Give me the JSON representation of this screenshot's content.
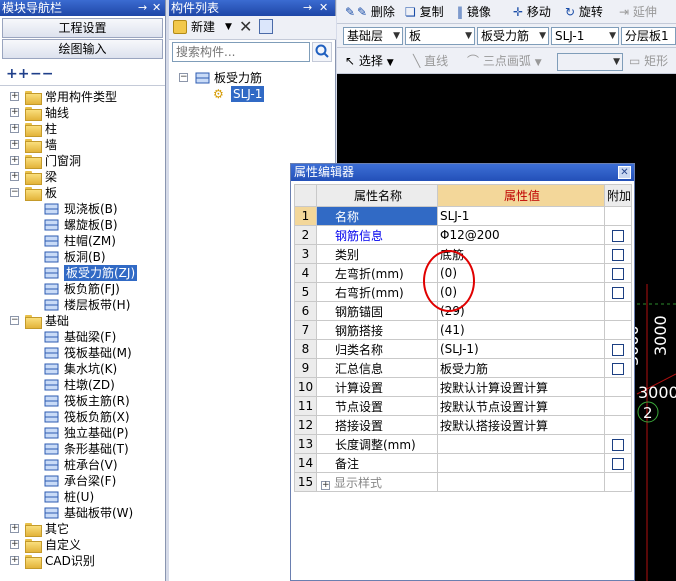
{
  "nav": {
    "title": "模块导航栏",
    "btn_project": "工程设置",
    "btn_draw": "绘图输入",
    "tree": [
      {
        "label": "常用构件类型",
        "indent": 0,
        "folder": true,
        "open": false
      },
      {
        "label": "轴线",
        "indent": 0,
        "folder": true,
        "open": false
      },
      {
        "label": "柱",
        "indent": 0,
        "folder": true,
        "open": false
      },
      {
        "label": "墙",
        "indent": 0,
        "folder": true,
        "open": false
      },
      {
        "label": "门窗洞",
        "indent": 0,
        "folder": true,
        "open": false
      },
      {
        "label": "梁",
        "indent": 0,
        "folder": true,
        "open": false
      },
      {
        "label": "板",
        "indent": 0,
        "folder": true,
        "open": true
      },
      {
        "label": "现浇板(B)",
        "indent": 1,
        "icon": "slab-icon"
      },
      {
        "label": "螺旋板(B)",
        "indent": 1,
        "icon": "spiral-slab-icon"
      },
      {
        "label": "柱帽(ZM)",
        "indent": 1,
        "icon": "column-cap-icon"
      },
      {
        "label": "板洞(B)",
        "indent": 1,
        "icon": "slab-hole-icon"
      },
      {
        "label": "板受力筋(ZJ)",
        "indent": 1,
        "icon": "slab-rebar-icon",
        "selected": true
      },
      {
        "label": "板负筋(FJ)",
        "indent": 1,
        "icon": "negative-rebar-icon"
      },
      {
        "label": "楼层板带(H)",
        "indent": 1,
        "icon": "slab-strip-icon"
      },
      {
        "label": "基础",
        "indent": 0,
        "folder": true,
        "open": true
      },
      {
        "label": "基础梁(F)",
        "indent": 1,
        "icon": "foundation-beam-icon"
      },
      {
        "label": "筏板基础(M)",
        "indent": 1,
        "icon": "raft-foundation-icon"
      },
      {
        "label": "集水坑(K)",
        "indent": 1,
        "icon": "sump-pit-icon"
      },
      {
        "label": "柱墩(ZD)",
        "indent": 1,
        "icon": "pier-icon"
      },
      {
        "label": "筏板主筋(R)",
        "indent": 1,
        "icon": "raft-main-rebar-icon"
      },
      {
        "label": "筏板负筋(X)",
        "indent": 1,
        "icon": "raft-negative-rebar-icon"
      },
      {
        "label": "独立基础(P)",
        "indent": 1,
        "icon": "isolated-footing-icon"
      },
      {
        "label": "条形基础(T)",
        "indent": 1,
        "icon": "strip-footing-icon"
      },
      {
        "label": "桩承台(V)",
        "indent": 1,
        "icon": "pile-cap-icon"
      },
      {
        "label": "承台梁(F)",
        "indent": 1,
        "icon": "cap-beam-icon"
      },
      {
        "label": "桩(U)",
        "indent": 1,
        "icon": "pile-icon"
      },
      {
        "label": "基础板带(W)",
        "indent": 1,
        "icon": "foundation-strip-icon"
      },
      {
        "label": "其它",
        "indent": 0,
        "folder": true,
        "open": false
      },
      {
        "label": "自定义",
        "indent": 0,
        "folder": true,
        "open": false
      },
      {
        "label": "CAD识别",
        "indent": 0,
        "folder": true,
        "open": false
      }
    ]
  },
  "comp": {
    "title": "构件列表",
    "new_label": "新建",
    "search_placeholder": "搜索构件...",
    "tree_root": "板受力筋",
    "tree_child": "SLJ-1"
  },
  "toolbar": {
    "delete": "删除",
    "copy": "复制",
    "mirror": "镜像",
    "move": "移动",
    "rotate": "旋转",
    "extend": "延伸",
    "select": "选择",
    "line": "直线",
    "arc": "三点画弧",
    "rect": "矩形",
    "combo_floor": "基础层",
    "combo_type": "板",
    "combo_sub": "板受力筋",
    "combo_name": "SLJ-1",
    "combo_layer": "分层板1"
  },
  "canvas": {
    "labels": [
      "3000",
      "3000",
      "3000",
      "2"
    ]
  },
  "dialog": {
    "title": "属性编辑器",
    "col_name": "属性名称",
    "col_value": "属性值",
    "col_extra": "附加",
    "rows": [
      {
        "n": "1",
        "name": "名称",
        "value": "SLJ-1",
        "check": false,
        "selected": true
      },
      {
        "n": "2",
        "name": "钢筋信息",
        "value": "Φ12@200",
        "check": true,
        "blue": true
      },
      {
        "n": "3",
        "name": "类别",
        "value": "底筋",
        "check": true
      },
      {
        "n": "4",
        "name": "左弯折(mm)",
        "value": "(0)",
        "check": true
      },
      {
        "n": "5",
        "name": "右弯折(mm)",
        "value": "(0)",
        "check": true
      },
      {
        "n": "6",
        "name": "钢筋锚固",
        "value": "(29)",
        "check": false
      },
      {
        "n": "7",
        "name": "钢筋搭接",
        "value": "(41)",
        "check": false
      },
      {
        "n": "8",
        "name": "归类名称",
        "value": "(SLJ-1)",
        "check": true
      },
      {
        "n": "9",
        "name": "汇总信息",
        "value": "板受力筋",
        "check": true
      },
      {
        "n": "10",
        "name": "计算设置",
        "value": "按默认计算设置计算",
        "check": false
      },
      {
        "n": "11",
        "name": "节点设置",
        "value": "按默认节点设置计算",
        "check": false
      },
      {
        "n": "12",
        "name": "搭接设置",
        "value": "按默认搭接设置计算",
        "check": false
      },
      {
        "n": "13",
        "name": "长度调整(mm)",
        "value": "",
        "check": true
      },
      {
        "n": "14",
        "name": "备注",
        "value": "",
        "check": true
      },
      {
        "n": "15",
        "name": "显示样式",
        "value": "",
        "check": false,
        "gray": true,
        "expandable": true
      }
    ]
  }
}
